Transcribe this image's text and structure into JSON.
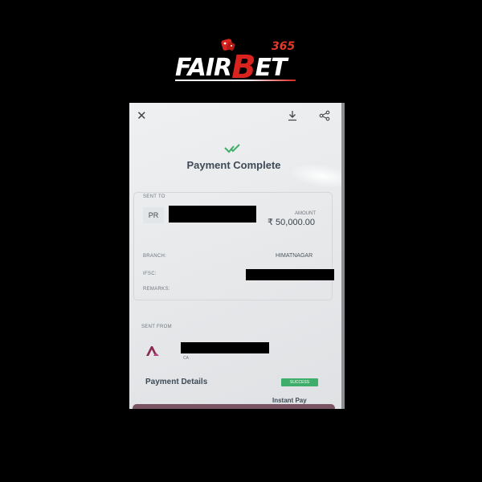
{
  "logo": {
    "word_start": "FAIR",
    "word_b": "B",
    "word_end": "ET",
    "superscript": "365"
  },
  "topbar": {
    "close_glyph": "✕",
    "download_icon": "download-icon",
    "share_icon": "share-icon"
  },
  "status": {
    "icon": "check-icon",
    "title": "Payment Complete"
  },
  "recipient": {
    "sent_to_label": "SENT TO",
    "initials": "PR",
    "amount_label": "AMOUNT",
    "amount_value": "₹ 50,000.00",
    "branch_label": "BRANCH:",
    "branch_value": "HIMATNAGAR",
    "ifsc_label": "IFSC:",
    "remarks_label": "REMARKS:"
  },
  "sender": {
    "sent_from_label": "SENT FROM",
    "bank_icon": "bank-logo-icon",
    "account_type": "CA"
  },
  "details": {
    "title": "Payment Details",
    "status_badge": "SUCCESS",
    "partial_text": "Instant Pay"
  },
  "colors": {
    "success": "#3fae6a",
    "brand_red": "#d9231f",
    "check": "#3fae6a"
  }
}
